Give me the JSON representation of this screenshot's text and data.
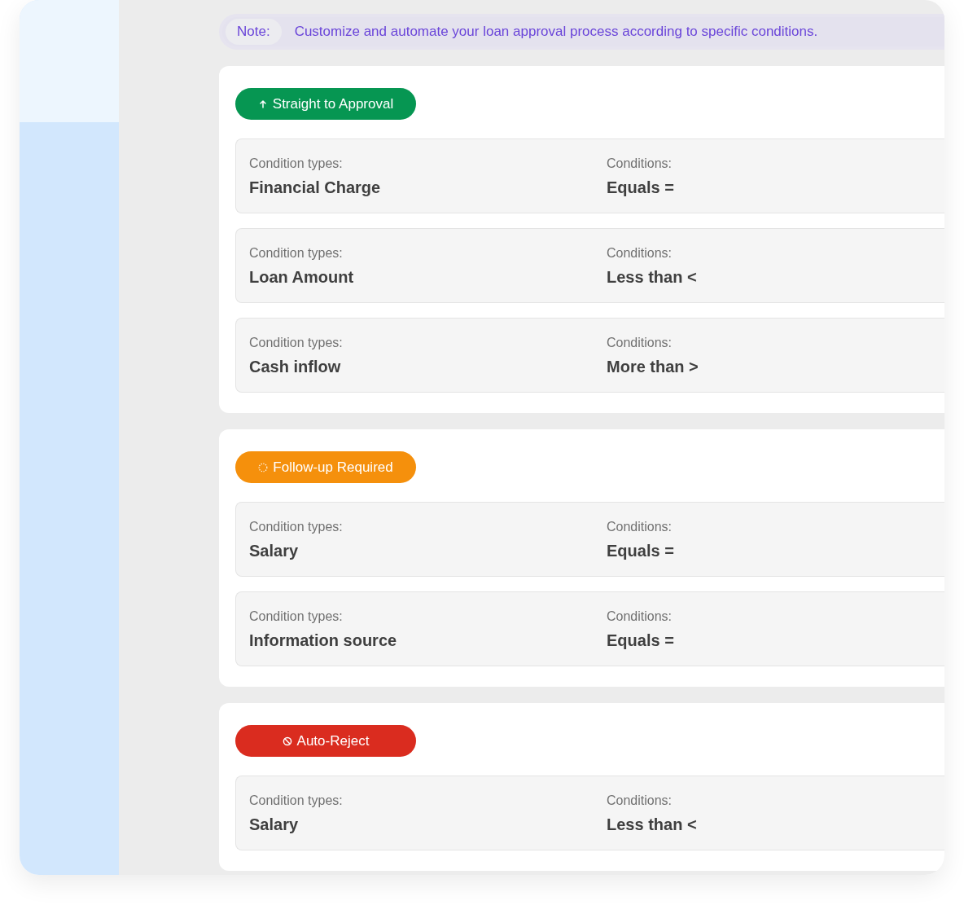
{
  "note": {
    "label": "Note:",
    "text": "Customize and automate your loan approval process according to specific conditions."
  },
  "groups": [
    {
      "kind": "approval",
      "title": "Straight to Approval",
      "rows": [
        {
          "type_label": "Condition types:",
          "type_value": "Financial Charge",
          "condition_label": "Conditions:",
          "condition_value": "Equals ="
        },
        {
          "type_label": "Condition types:",
          "type_value": "Loan Amount",
          "condition_label": "Conditions:",
          "condition_value": "Less than <"
        },
        {
          "type_label": "Condition types:",
          "type_value": "Cash inflow",
          "condition_label": "Conditions:",
          "condition_value": "More than >"
        }
      ]
    },
    {
      "kind": "followup",
      "title": "Follow-up Required",
      "rows": [
        {
          "type_label": "Condition types:",
          "type_value": "Salary",
          "condition_label": "Conditions:",
          "condition_value": "Equals ="
        },
        {
          "type_label": "Condition types:",
          "type_value": "Information source",
          "condition_label": "Conditions:",
          "condition_value": "Equals ="
        }
      ]
    },
    {
      "kind": "reject",
      "title": "Auto-Reject",
      "rows": [
        {
          "type_label": "Condition types:",
          "type_value": "Salary",
          "condition_label": "Conditions:",
          "condition_value": "Less than <"
        }
      ]
    }
  ]
}
